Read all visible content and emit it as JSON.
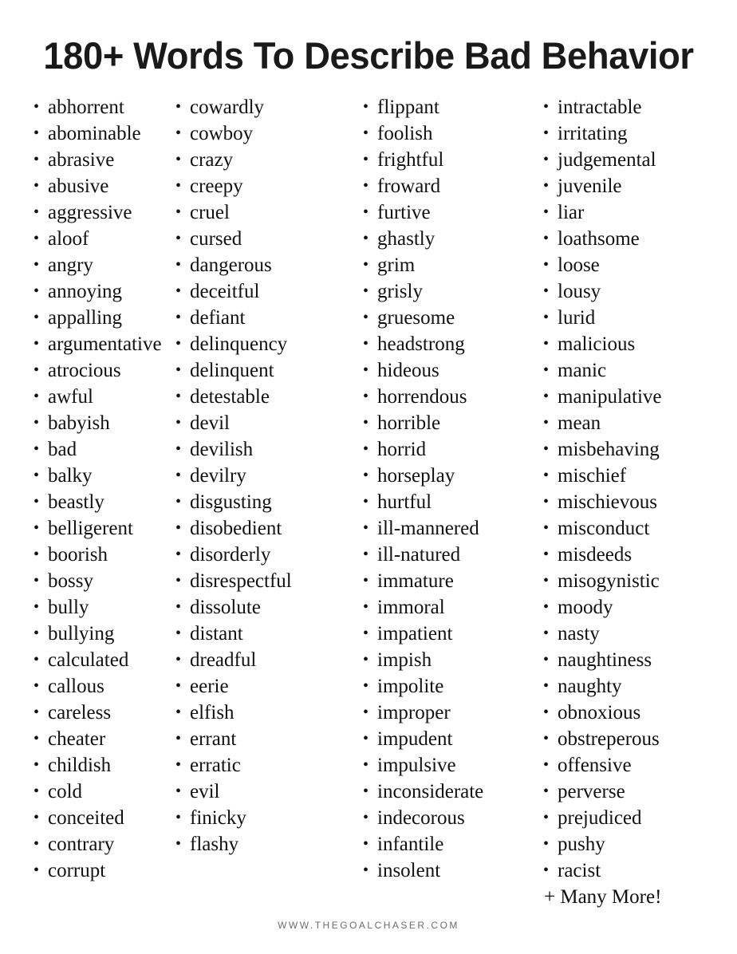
{
  "page": {
    "title": "180+ Words To Describe Bad Behavior",
    "background_color": "#ffffff",
    "text_color": "#111111",
    "footer_color": "#6d6d6d"
  },
  "footer": {
    "website": "WWW.THEGOALCHASER.COM"
  },
  "bullet_glyph": "•",
  "more_label": "+ Many More!",
  "columns": [
    {
      "index": 1,
      "words": [
        "abhorrent",
        "abominable",
        "abrasive",
        "abusive",
        "aggressive",
        "aloof",
        "angry",
        "annoying",
        "appalling",
        "argumentative",
        "atrocious",
        "awful",
        "babyish",
        "bad",
        "balky",
        "beastly",
        "belligerent",
        "boorish",
        "bossy",
        "bully",
        "bullying",
        "calculated",
        "callous",
        "careless",
        "cheater",
        "childish",
        "cold",
        "conceited",
        "contrary",
        "corrupt"
      ]
    },
    {
      "index": 2,
      "words": [
        "cowardly",
        "cowboy",
        "crazy",
        "creepy",
        "cruel",
        "cursed",
        "dangerous",
        "deceitful",
        "defiant",
        "delinquency",
        "delinquent",
        "detestable",
        "devil",
        "devilish",
        "devilry",
        "disgusting",
        "disobedient",
        "disorderly",
        "disrespectful",
        "dissolute",
        "distant",
        "dreadful",
        "eerie",
        "elfish",
        "errant",
        "erratic",
        "evil",
        "finicky",
        "flashy"
      ]
    },
    {
      "index": 3,
      "words": [
        "flippant",
        "foolish",
        "frightful",
        "froward",
        "furtive",
        "ghastly",
        "grim",
        "grisly",
        "gruesome",
        "headstrong",
        "hideous",
        "horrendous",
        "horrible",
        "horrid",
        "horseplay",
        "hurtful",
        "ill-mannered",
        "ill-natured",
        "immature",
        "immoral",
        "impatient",
        "impish",
        "impolite",
        "improper",
        "impudent",
        "impulsive",
        "inconsiderate",
        "indecorous",
        "infantile",
        "insolent"
      ]
    },
    {
      "index": 4,
      "words": [
        "intractable",
        "irritating",
        "judgemental",
        "juvenile",
        "liar",
        "loathsome",
        "loose",
        "lousy",
        "lurid",
        "malicious",
        "manic",
        "manipulative",
        "mean",
        "misbehaving",
        "mischief",
        "mischievous",
        "misconduct",
        "misdeeds",
        "misogynistic",
        "moody",
        "nasty",
        "naughtiness",
        "naughty",
        "obnoxious",
        "obstreperous",
        "offensive",
        "perverse",
        "prejudiced",
        "pushy",
        "racist"
      ],
      "trailing_note": "+ Many More!"
    }
  ]
}
